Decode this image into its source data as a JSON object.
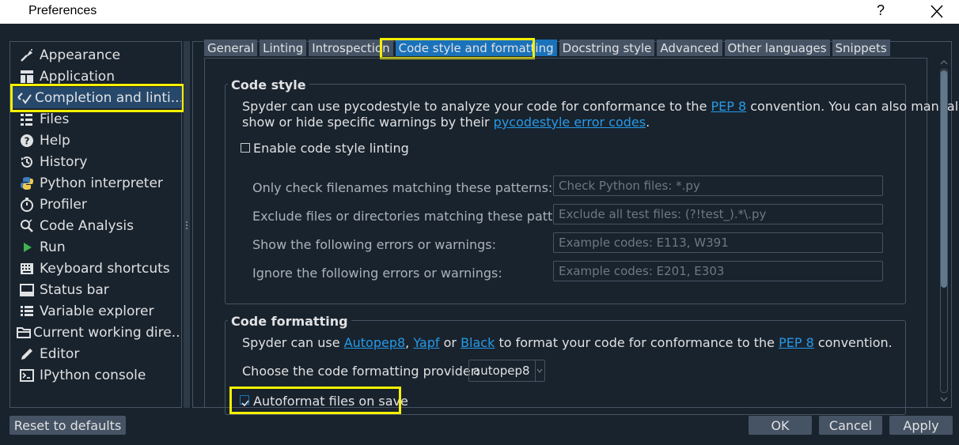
{
  "window": {
    "title": "Preferences",
    "help_label": "?"
  },
  "sidebar": {
    "items": [
      {
        "label": "Appearance",
        "icon": "paintbrush-icon"
      },
      {
        "label": "Application",
        "icon": "application-icon"
      },
      {
        "label": "Completion and linti...",
        "icon": "completion-icon",
        "selected": true
      },
      {
        "label": "Files",
        "icon": "files-icon"
      },
      {
        "label": "Help",
        "icon": "help-icon"
      },
      {
        "label": "History",
        "icon": "history-icon"
      },
      {
        "label": "Python interpreter",
        "icon": "python-icon"
      },
      {
        "label": "Profiler",
        "icon": "stopwatch-icon"
      },
      {
        "label": "Code Analysis",
        "icon": "code-analysis-icon"
      },
      {
        "label": "Run",
        "icon": "run-icon"
      },
      {
        "label": "Keyboard shortcuts",
        "icon": "keyboard-icon"
      },
      {
        "label": "Status bar",
        "icon": "statusbar-icon"
      },
      {
        "label": "Variable explorer",
        "icon": "list-icon"
      },
      {
        "label": "Current working dire...",
        "icon": "folder-icon"
      },
      {
        "label": "Editor",
        "icon": "pencil-icon"
      },
      {
        "label": "IPython console",
        "icon": "console-icon"
      }
    ]
  },
  "tabs": [
    {
      "label": "General"
    },
    {
      "label": "Linting"
    },
    {
      "label": "Introspection"
    },
    {
      "label": "Code style and formatting",
      "active": true
    },
    {
      "label": "Docstring style"
    },
    {
      "label": "Advanced"
    },
    {
      "label": "Other languages"
    },
    {
      "label": "Snippets"
    }
  ],
  "code_style": {
    "title": "Code style",
    "desc_line1_a": "Spyder can use pycodestyle to analyze your code for conformance to the ",
    "desc_line1_link": "PEP 8",
    "desc_line1_b": " convention. You can also manually",
    "desc_line2_a": "show or hide specific warnings by their ",
    "desc_line2_link": "pycodestyle error codes",
    "desc_line2_b": ".",
    "enable_label": "Enable code style linting",
    "enable_checked": false,
    "fields": [
      {
        "label": "Only check filenames matching these patterns:",
        "placeholder": "Check Python files: *.py"
      },
      {
        "label": "Exclude files or directories matching these patterns:",
        "placeholder": "Exclude all test files: (?!test_).*\\.py"
      },
      {
        "label": "Show the following errors or warnings:",
        "placeholder": "Example codes: E113, W391"
      },
      {
        "label": "Ignore the following errors or warnings:",
        "placeholder": "Example codes: E201, E303"
      }
    ]
  },
  "code_formatting": {
    "title": "Code formatting",
    "desc_a": "Spyder can use ",
    "link_autopep8": "Autopep8",
    "sep1": ", ",
    "link_yapf": "Yapf",
    "sep2": " or ",
    "link_black": "Black",
    "desc_b": " to format your code for conformance to the ",
    "link_pep8": "PEP 8",
    "desc_c": " convention.",
    "provider_label": "Choose the code formatting provider:",
    "provider_value": "autopep8",
    "autoformat_label": "Autoformat files on save",
    "autoformat_checked": true
  },
  "buttons": {
    "reset": "Reset to defaults",
    "ok": "OK",
    "cancel": "Cancel",
    "apply": "Apply"
  },
  "colors": {
    "background": "#19232d",
    "accent": "#1a72bb",
    "link": "#259ae9",
    "highlight": "#f6f000"
  }
}
